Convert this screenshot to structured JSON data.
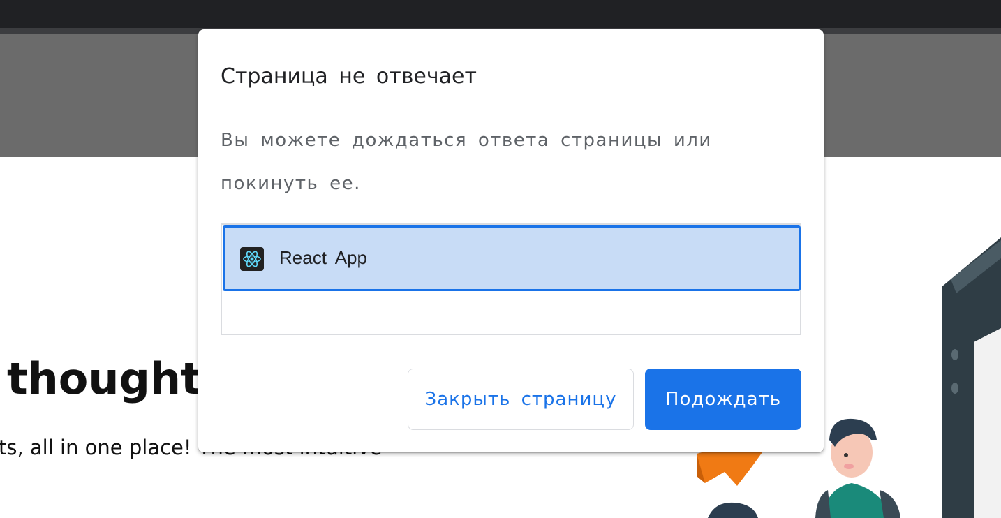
{
  "background_page": {
    "hero_title": " thought",
    "hero_subtitle": "ts, all in one place! The most intuitive"
  },
  "dialog": {
    "title": "Страница не отвечает",
    "message": "Вы можете дождаться ответа страницы или покинуть ее.",
    "pages": [
      {
        "label": "React App",
        "icon": "react-icon",
        "selected": true
      }
    ],
    "buttons": {
      "close_label": "Закрыть страницу",
      "wait_label": "Подождать"
    }
  },
  "colors": {
    "accent": "#1a73e8",
    "selected_row": "#c8dcf6",
    "dim_header": "#6b6b6b",
    "chrome": "#202124"
  }
}
